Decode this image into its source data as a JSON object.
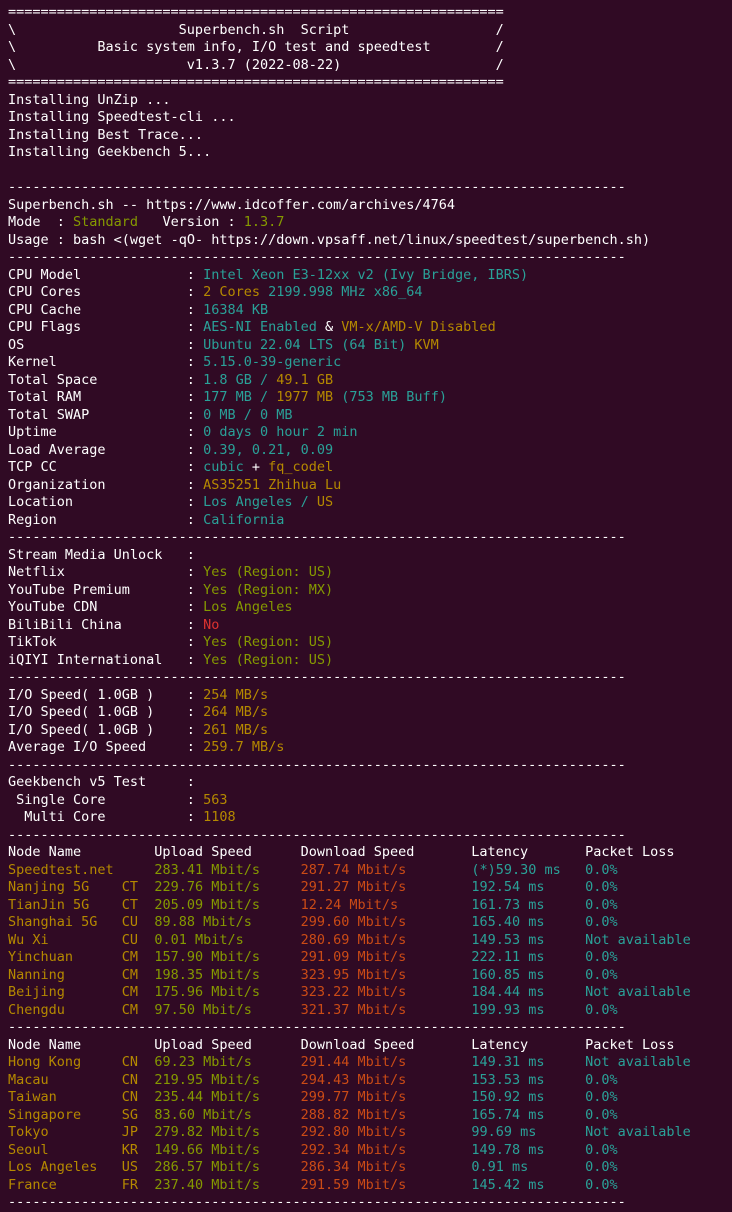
{
  "terminal": {
    "background_color": "#300a24",
    "foreground_color": "#ffffff",
    "colors": {
      "cyan": "#2aa198",
      "yellow": "#b58900",
      "green": "#859900",
      "red_orange": "#cb4b16",
      "red": "#dc322f",
      "white": "#ffffff"
    },
    "separator_equals": "=============================================================",
    "separator_dots": "----------------------------------------------------------------------------"
  },
  "banner": {
    "line1_left": "\\",
    "line1_text": "Superbench.sh  Script",
    "line1_right": "/",
    "line2_left": "\\",
    "line2_text": "Basic system info, I/O test and speedtest",
    "line2_right": "/",
    "line3_left": "\\",
    "line3_text": "v1.3.7 (2022-08-22)",
    "line3_right": "/"
  },
  "install_log": [
    "Installing UnZip ...",
    "Installing Speedtest-cli ...",
    "Installing Best Trace...",
    "Installing Geekbench 5..."
  ],
  "script_info": {
    "title_line": "Superbench.sh -- https://www.idcoffer.com/archives/4764",
    "mode_label": "Mode  : ",
    "mode_value": "Standard",
    "version_label": "   Version : ",
    "version_value": "1.3.7",
    "usage_label": "Usage : ",
    "usage_value": "bash <(wget -qO- https://down.vpsaff.net/linux/speedtest/superbench.sh)"
  },
  "system_info": [
    {
      "label": "CPU Model",
      "parts": [
        {
          "t": "Intel Xeon E3-12xx v2 (Ivy Bridge, IBRS)",
          "c": "c"
        }
      ]
    },
    {
      "label": "CPU Cores",
      "parts": [
        {
          "t": "2 Cores",
          "c": "y"
        },
        {
          "t": " ",
          "c": "w"
        },
        {
          "t": "2199.998 MHz x86_64",
          "c": "c"
        }
      ]
    },
    {
      "label": "CPU Cache",
      "parts": [
        {
          "t": "16384 KB",
          "c": "c"
        }
      ]
    },
    {
      "label": "CPU Flags",
      "parts": [
        {
          "t": "AES-NI Enabled",
          "c": "c"
        },
        {
          "t": " & ",
          "c": "w"
        },
        {
          "t": "VM-x/AMD-V Disabled",
          "c": "y"
        }
      ]
    },
    {
      "label": "OS",
      "parts": [
        {
          "t": "Ubuntu 22.04 LTS (64 Bit)",
          "c": "c"
        },
        {
          "t": " ",
          "c": "w"
        },
        {
          "t": "KVM",
          "c": "y"
        }
      ]
    },
    {
      "label": "Kernel",
      "parts": [
        {
          "t": "5.15.0-39-generic",
          "c": "c"
        }
      ]
    },
    {
      "label": "Total Space",
      "parts": [
        {
          "t": "1.8 GB",
          "c": "c"
        },
        {
          "t": " / ",
          "c": "c"
        },
        {
          "t": "49.1 GB",
          "c": "y"
        }
      ]
    },
    {
      "label": "Total RAM",
      "parts": [
        {
          "t": "177 MB",
          "c": "c"
        },
        {
          "t": " / ",
          "c": "c"
        },
        {
          "t": "1977 MB",
          "c": "y"
        },
        {
          "t": " (753 MB Buff)",
          "c": "c"
        }
      ]
    },
    {
      "label": "Total SWAP",
      "parts": [
        {
          "t": "0 MB / 0 MB",
          "c": "c"
        }
      ]
    },
    {
      "label": "Uptime",
      "parts": [
        {
          "t": "0 days 0 hour 2 min",
          "c": "c"
        }
      ]
    },
    {
      "label": "Load Average",
      "parts": [
        {
          "t": "0.39, 0.21, 0.09",
          "c": "c"
        }
      ]
    },
    {
      "label": "TCP CC",
      "parts": [
        {
          "t": "cubic",
          "c": "c"
        },
        {
          "t": " + ",
          "c": "w"
        },
        {
          "t": "fq_codel",
          "c": "y"
        }
      ]
    },
    {
      "label": "Organization",
      "parts": [
        {
          "t": "AS35251 Zhihua Lu",
          "c": "y"
        }
      ]
    },
    {
      "label": "Location",
      "parts": [
        {
          "t": "Los Angeles",
          "c": "c"
        },
        {
          "t": " / ",
          "c": "c"
        },
        {
          "t": "US",
          "c": "y"
        }
      ]
    },
    {
      "label": "Region",
      "parts": [
        {
          "t": "California",
          "c": "c"
        }
      ]
    }
  ],
  "stream_unlock": {
    "header_label": "Stream Media Unlock",
    "header_value": "",
    "items": [
      {
        "label": "Netflix",
        "value": "Yes (Region: US)",
        "c": "g"
      },
      {
        "label": "YouTube Premium",
        "value": "Yes (Region: MX)",
        "c": "g"
      },
      {
        "label": "YouTube CDN",
        "value": "Los Angeles",
        "c": "g"
      },
      {
        "label": "BiliBili China",
        "value": "No",
        "c": "rd"
      },
      {
        "label": "TikTok",
        "value": "Yes (Region: US)",
        "c": "g"
      },
      {
        "label": "iQIYI International",
        "value": "Yes (Region: US)",
        "c": "g"
      }
    ]
  },
  "io_speed": {
    "items": [
      {
        "label": "I/O Speed( 1.0GB )",
        "value": "254 MB/s"
      },
      {
        "label": "I/O Speed( 1.0GB )",
        "value": "264 MB/s"
      },
      {
        "label": "I/O Speed( 1.0GB )",
        "value": "261 MB/s"
      },
      {
        "label": "Average I/O Speed",
        "value": "259.7 MB/s"
      }
    ]
  },
  "geekbench": {
    "header_label": "Geekbench v5 Test",
    "header_value": "",
    "items": [
      {
        "label": "Single Core",
        "value": "563"
      },
      {
        "label": "Multi Core",
        "value": "1108"
      }
    ]
  },
  "speedtest_domestic": {
    "headers": [
      "Node Name",
      "Upload Speed",
      "Download Speed",
      "Latency",
      "Packet Loss"
    ],
    "rows": [
      {
        "node": "Speedtest.net",
        "isp": "",
        "upload": "283.41 Mbit/s",
        "download": "287.74 Mbit/s",
        "latency": "(*)59.30 ms",
        "loss": "0.0%"
      },
      {
        "node": "Nanjing 5G",
        "isp": "CT",
        "upload": "229.76 Mbit/s",
        "download": "291.27 Mbit/s",
        "latency": "192.54 ms",
        "loss": "0.0%"
      },
      {
        "node": "TianJin 5G",
        "isp": "CT",
        "upload": "205.09 Mbit/s",
        "download": "12.24 Mbit/s",
        "latency": "161.73 ms",
        "loss": "0.0%"
      },
      {
        "node": "Shanghai 5G",
        "isp": "CU",
        "upload": "89.88 Mbit/s",
        "download": "299.60 Mbit/s",
        "latency": "165.40 ms",
        "loss": "0.0%"
      },
      {
        "node": "Wu Xi",
        "isp": "CU",
        "upload": "0.01 Mbit/s",
        "download": "280.69 Mbit/s",
        "latency": "149.53 ms",
        "loss": "Not available"
      },
      {
        "node": "Yinchuan",
        "isp": "CM",
        "upload": "157.90 Mbit/s",
        "download": "291.09 Mbit/s",
        "latency": "222.11 ms",
        "loss": "0.0%"
      },
      {
        "node": "Nanning",
        "isp": "CM",
        "upload": "198.35 Mbit/s",
        "download": "323.95 Mbit/s",
        "latency": "160.85 ms",
        "loss": "0.0%"
      },
      {
        "node": "Beijing",
        "isp": "CM",
        "upload": "175.96 Mbit/s",
        "download": "323.22 Mbit/s",
        "latency": "184.44 ms",
        "loss": "Not available"
      },
      {
        "node": "Chengdu",
        "isp": "CM",
        "upload": "97.50 Mbit/s",
        "download": "321.37 Mbit/s",
        "latency": "199.93 ms",
        "loss": "0.0%"
      }
    ]
  },
  "speedtest_international": {
    "headers": [
      "Node Name",
      "Upload Speed",
      "Download Speed",
      "Latency",
      "Packet Loss"
    ],
    "rows": [
      {
        "node": "Hong Kong",
        "isp": "CN",
        "upload": "69.23 Mbit/s",
        "download": "291.44 Mbit/s",
        "latency": "149.31 ms",
        "loss": "Not available"
      },
      {
        "node": "Macau",
        "isp": "CN",
        "upload": "219.95 Mbit/s",
        "download": "294.43 Mbit/s",
        "latency": "153.53 ms",
        "loss": "0.0%"
      },
      {
        "node": "Taiwan",
        "isp": "CN",
        "upload": "235.44 Mbit/s",
        "download": "299.77 Mbit/s",
        "latency": "150.92 ms",
        "loss": "0.0%"
      },
      {
        "node": "Singapore",
        "isp": "SG",
        "upload": "83.60 Mbit/s",
        "download": "288.82 Mbit/s",
        "latency": "165.74 ms",
        "loss": "0.0%"
      },
      {
        "node": "Tokyo",
        "isp": "JP",
        "upload": "279.82 Mbit/s",
        "download": "292.80 Mbit/s",
        "latency": "99.69 ms",
        "loss": "Not available"
      },
      {
        "node": "Seoul",
        "isp": "KR",
        "upload": "149.66 Mbit/s",
        "download": "292.34 Mbit/s",
        "latency": "149.78 ms",
        "loss": "0.0%"
      },
      {
        "node": "Los Angeles",
        "isp": "US",
        "upload": "286.57 Mbit/s",
        "download": "286.34 Mbit/s",
        "latency": "0.91 ms",
        "loss": "0.0%"
      },
      {
        "node": "France",
        "isp": "FR",
        "upload": "237.40 Mbit/s",
        "download": "291.59 Mbit/s",
        "latency": "145.42 ms",
        "loss": "0.0%"
      }
    ]
  }
}
